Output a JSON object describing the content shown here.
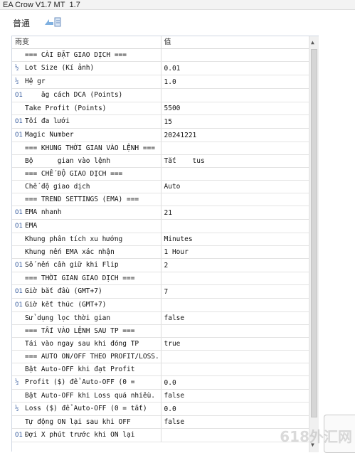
{
  "window": {
    "title": "EA Crow V1.7 MT  1.7"
  },
  "tabs": [
    {
      "label": "普通"
    }
  ],
  "table": {
    "columns": [
      "雨变",
      "值"
    ],
    "rows": [
      {
        "icon": "",
        "label": "=== CÀI ĐẶT GIAO DỊCH ===",
        "value": ""
      },
      {
        "icon": "½",
        "label": "Lot Size (Kí ảnh)",
        "value": "0.01"
      },
      {
        "icon": "½",
        "label": "Hệ gr      ",
        "value": "1.0"
      },
      {
        "icon": "O1",
        "label": "    ăg cách DCA (Points)",
        "value": ""
      },
      {
        "icon": "",
        "label": "Take Profit (Points)",
        "value": "5500"
      },
      {
        "icon": "O1",
        "label": "Tối đa lưới",
        "value": "15"
      },
      {
        "icon": "O1",
        "label": "Magic Number",
        "value": "20241221"
      },
      {
        "icon": "",
        "label": "=== KHUNG THỜI GIAN VÀO LỆNH ===",
        "value": ""
      },
      {
        "icon": "",
        "label": "Bộ      gian vào lệnh",
        "value": "Tắt    tus"
      },
      {
        "icon": "",
        "label": "=== CHẾ ĐỘ GIAO DỊCH ===",
        "value": ""
      },
      {
        "icon": "",
        "label": "Chế độ giao dịch",
        "value": "Auto"
      },
      {
        "icon": "",
        "label": "=== TREND SETTINGS (EMA) ===",
        "value": ""
      },
      {
        "icon": "O1",
        "label": "EMA nhanh",
        "value": "21"
      },
      {
        "icon": "O1",
        "label": "EMA     ",
        "value": ""
      },
      {
        "icon": "",
        "label": "Khung phân tích xu hướng",
        "value": "Minutes"
      },
      {
        "icon": "",
        "label": "Khung nến EMA xác nhận",
        "value": "1 Hour"
      },
      {
        "icon": "O1",
        "label": "Số nến cần giữ khi Flip",
        "value": "2"
      },
      {
        "icon": "",
        "label": "=== THỜI GIAN GIAO DỊCH ===",
        "value": ""
      },
      {
        "icon": "O1",
        "label": "Giờ bắt đầu (GMT+7)",
        "value": "7"
      },
      {
        "icon": "O1",
        "label": "Giờ kết thúc (GMT+7)",
        "value": ""
      },
      {
        "icon": "",
        "label": "Sử dụng lọc thời gian",
        "value": "false"
      },
      {
        "icon": "",
        "label": "=== TẤI VÀO LỆNH SAU TP ===",
        "value": ""
      },
      {
        "icon": "",
        "label": "Tái vào ngay sau khi đóng TP",
        "value": "true"
      },
      {
        "icon": "",
        "label": "=== AUTO ON/OFF THEO PROFIT/LOSS...",
        "value": ""
      },
      {
        "icon": "",
        "label": "Bật Auto-OFF khi đạt Profit",
        "value": ""
      },
      {
        "icon": "½",
        "label": "Profit ($) để Auto-OFF (0 =",
        "value": "0.0"
      },
      {
        "icon": "",
        "label": "Bật Auto-OFF khi Loss quá nhiều.",
        "value": "false"
      },
      {
        "icon": "½",
        "label": "Loss ($) để Auto-OFF (0 = tắt)",
        "value": "0.0"
      },
      {
        "icon": "",
        "label": "Tự động ON lại sau khi OFF",
        "value": "false"
      },
      {
        "icon": "O1",
        "label": "Đợi X phút trước khi ON lại",
        "value": ""
      }
    ]
  },
  "watermark": "618外汇网",
  "colors": {
    "accent": "#3a5fa0",
    "header_border": "#cfd7e2"
  }
}
